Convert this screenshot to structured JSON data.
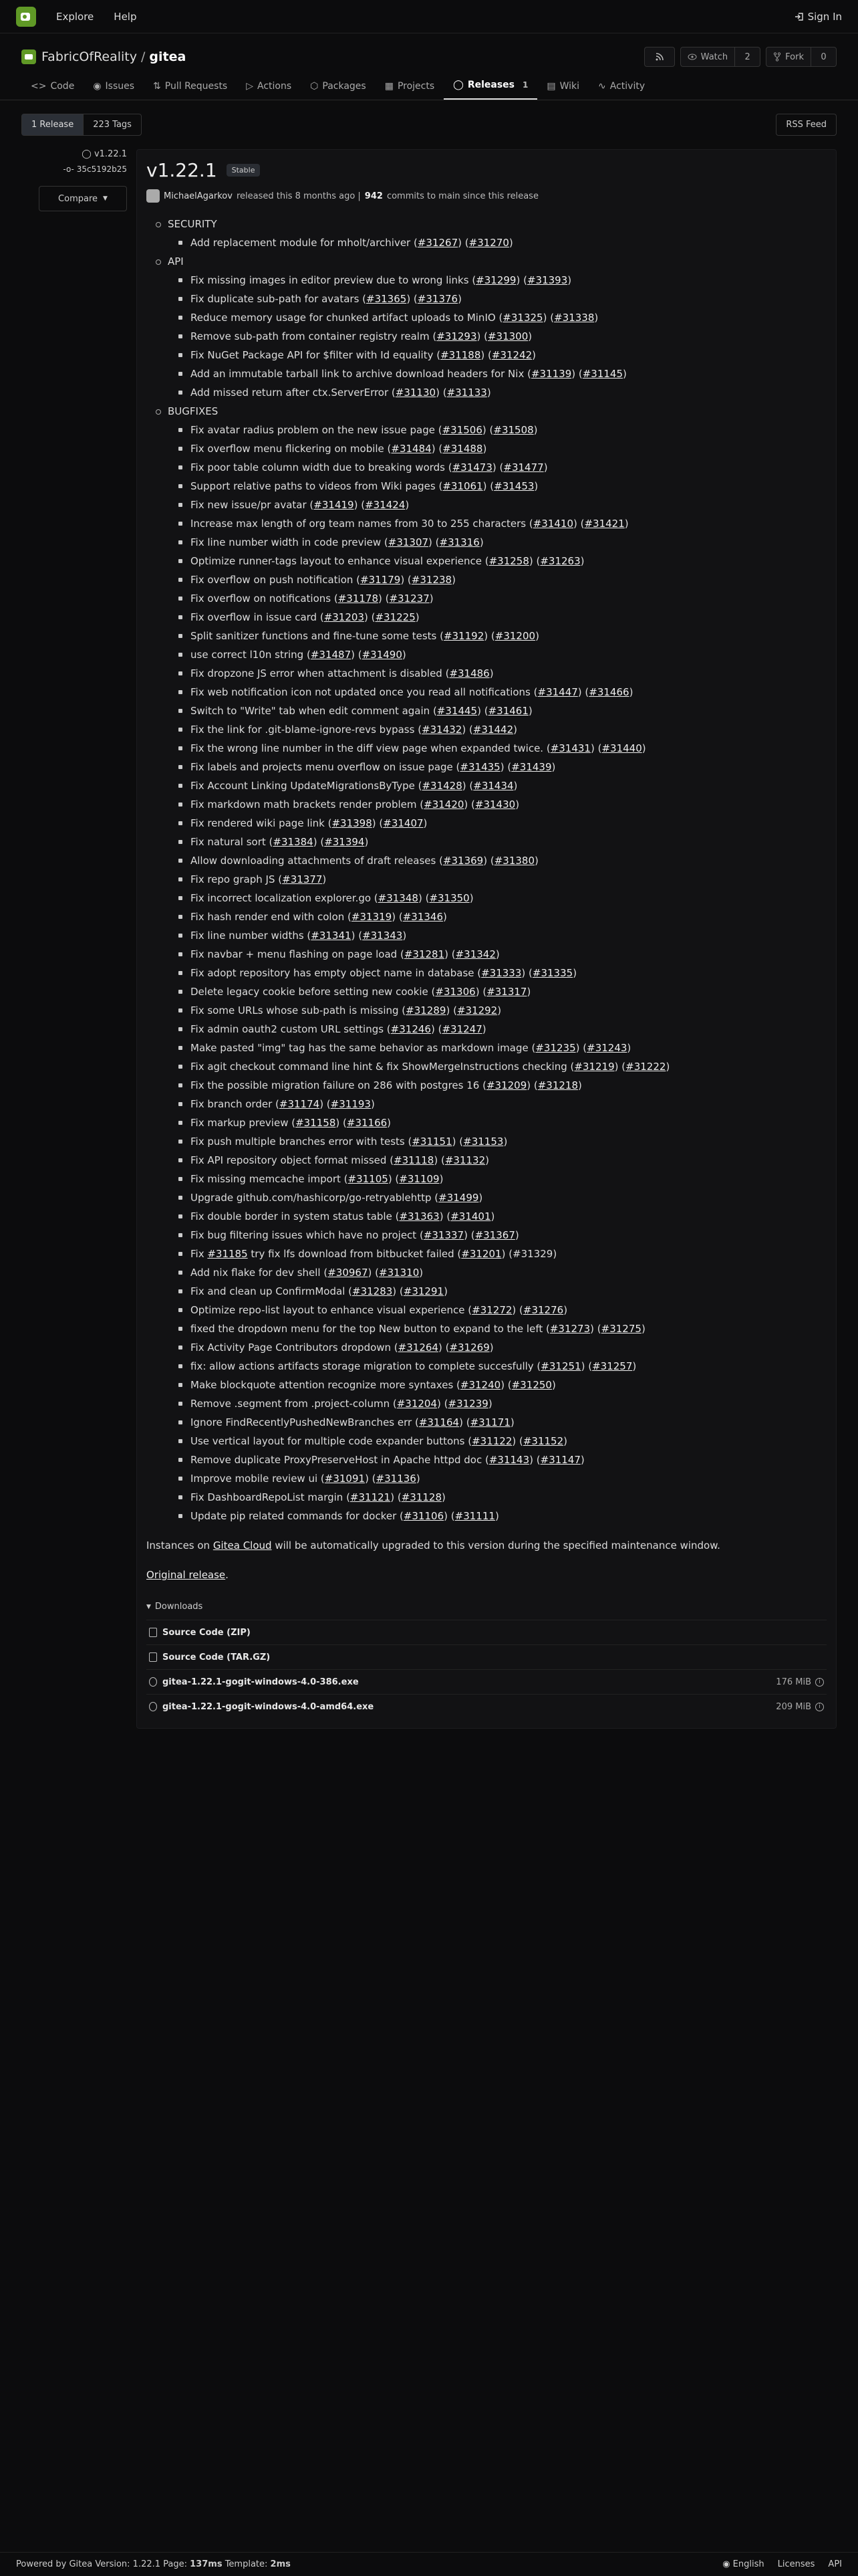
{
  "nav": {
    "explore": "Explore",
    "help": "Help",
    "sign_in": "Sign In"
  },
  "repo": {
    "owner": "FabricOfReality",
    "name": "gitea",
    "watch_label": "Watch",
    "watch_count": "2",
    "fork_label": "Fork",
    "fork_count": "0"
  },
  "tabs": [
    {
      "label": "Code"
    },
    {
      "label": "Issues"
    },
    {
      "label": "Pull Requests"
    },
    {
      "label": "Actions"
    },
    {
      "label": "Packages"
    },
    {
      "label": "Projects"
    },
    {
      "label": "Releases",
      "count": "1"
    },
    {
      "label": "Wiki"
    },
    {
      "label": "Activity"
    }
  ],
  "subbar": {
    "releases": "1 Release",
    "tags": "223 Tags",
    "rss": "RSS Feed"
  },
  "sidebar": {
    "tag": "v1.22.1",
    "commit": "35c5192b25",
    "compare": "Compare"
  },
  "release": {
    "version": "v1.22.1",
    "badge": "Stable",
    "author": "MichaelAgarkov",
    "released_text": "released this 8 months ago |",
    "commits": "942",
    "commits_text": "commits to main since this release"
  },
  "notes": [
    {
      "heading": "SECURITY",
      "items": [
        [
          "Add replacement module for mholt/archiver (",
          "#31267",
          ") (",
          "#31270",
          ")"
        ]
      ]
    },
    {
      "heading": "API",
      "items": [
        [
          "Fix missing images in editor preview due to wrong links (",
          "#31299",
          ") (",
          "#31393",
          ")"
        ],
        [
          "Fix duplicate sub-path for avatars (",
          "#31365",
          ") (",
          "#31376",
          ")"
        ],
        [
          "Reduce memory usage for chunked artifact uploads to MinIO (",
          "#31325",
          ") (",
          "#31338",
          ")"
        ],
        [
          "Remove sub-path from container registry realm (",
          "#31293",
          ") (",
          "#31300",
          ")"
        ],
        [
          "Fix NuGet Package API for $filter with Id equality (",
          "#31188",
          ") (",
          "#31242",
          ")"
        ],
        [
          "Add an immutable tarball link to archive download headers for Nix (",
          "#31139",
          ") (",
          "#31145",
          ")"
        ],
        [
          "Add missed return after ctx.ServerError (",
          "#31130",
          ") (",
          "#31133",
          ")"
        ]
      ]
    },
    {
      "heading": "BUGFIXES",
      "items": [
        [
          "Fix avatar radius problem on the new issue page (",
          "#31506",
          ") (",
          "#31508",
          ")"
        ],
        [
          "Fix overflow menu flickering on mobile (",
          "#31484",
          ") (",
          "#31488",
          ")"
        ],
        [
          "Fix poor table column width due to breaking words (",
          "#31473",
          ") (",
          "#31477",
          ")"
        ],
        [
          "Support relative paths to videos from Wiki pages (",
          "#31061",
          ") (",
          "#31453",
          ")"
        ],
        [
          "Fix new issue/pr avatar (",
          "#31419",
          ") (",
          "#31424",
          ")"
        ],
        [
          "Increase max length of org team names from 30 to 255 characters (",
          "#31410",
          ") (",
          "#31421",
          ")"
        ],
        [
          "Fix line number width in code preview (",
          "#31307",
          ") (",
          "#31316",
          ")"
        ],
        [
          "Optimize runner-tags layout to enhance visual experience (",
          "#31258",
          ") (",
          "#31263",
          ")"
        ],
        [
          "Fix overflow on push notification (",
          "#31179",
          ") (",
          "#31238",
          ")"
        ],
        [
          "Fix overflow on notifications (",
          "#31178",
          ") (",
          "#31237",
          ")"
        ],
        [
          "Fix overflow in issue card (",
          "#31203",
          ") (",
          "#31225",
          ")"
        ],
        [
          "Split sanitizer functions and fine-tune some tests (",
          "#31192",
          ") (",
          "#31200",
          ")"
        ],
        [
          "use correct l10n string (",
          "#31487",
          ") (",
          "#31490",
          ")"
        ],
        [
          "Fix dropzone JS error when attachment is disabled (",
          "#31486",
          ")",
          "",
          ""
        ],
        [
          "Fix web notification icon not updated once you read all notifications (",
          "#31447",
          ") (",
          "#31466",
          ")"
        ],
        [
          "Switch to \"Write\" tab when edit comment again (",
          "#31445",
          ") (",
          "#31461",
          ")"
        ],
        [
          "Fix the link for .git-blame-ignore-revs bypass (",
          "#31432",
          ") (",
          "#31442",
          ")"
        ],
        [
          "Fix the wrong line number in the diff view page when expanded twice. (",
          "#31431",
          ") (",
          "#31440",
          ")"
        ],
        [
          "Fix labels and projects menu overflow on issue page (",
          "#31435",
          ") (",
          "#31439",
          ")"
        ],
        [
          "Fix Account Linking UpdateMigrationsByType (",
          "#31428",
          ") (",
          "#31434",
          ")"
        ],
        [
          "Fix markdown math brackets render problem (",
          "#31420",
          ") (",
          "#31430",
          ")"
        ],
        [
          "Fix rendered wiki page link (",
          "#31398",
          ") (",
          "#31407",
          ")"
        ],
        [
          "Fix natural sort (",
          "#31384",
          ") (",
          "#31394",
          ")"
        ],
        [
          "Allow downloading attachments of draft releases (",
          "#31369",
          ") (",
          "#31380",
          ")"
        ],
        [
          "Fix repo graph JS (",
          "#31377",
          ")",
          "",
          ""
        ],
        [
          "Fix incorrect localization explorer.go (",
          "#31348",
          ") (",
          "#31350",
          ")"
        ],
        [
          "Fix hash render end with colon (",
          "#31319",
          ") (",
          "#31346",
          ")"
        ],
        [
          "Fix line number widths (",
          "#31341",
          ") (",
          "#31343",
          ")"
        ],
        [
          "Fix navbar + menu flashing on page load (",
          "#31281",
          ") (",
          "#31342",
          ")"
        ],
        [
          "Fix adopt repository has empty object name in database (",
          "#31333",
          ") (",
          "#31335",
          ")"
        ],
        [
          "Delete legacy cookie before setting new cookie (",
          "#31306",
          ") (",
          "#31317",
          ")"
        ],
        [
          "Fix some URLs whose sub-path is missing (",
          "#31289",
          ") (",
          "#31292",
          ")"
        ],
        [
          "Fix admin oauth2 custom URL settings (",
          "#31246",
          ") (",
          "#31247",
          ")"
        ],
        [
          "Make pasted \"img\" tag has the same behavior as markdown image (",
          "#31235",
          ") (",
          "#31243",
          ")"
        ],
        [
          "Fix agit checkout command line hint & fix ShowMergeInstructions checking (",
          "#31219",
          ") (",
          "#31222",
          ")"
        ],
        [
          "Fix the possible migration failure on 286 with postgres 16 (",
          "#31209",
          ") (",
          "#31218",
          ")"
        ],
        [
          "Fix branch order (",
          "#31174",
          ") (",
          "#31193",
          ")"
        ],
        [
          "Fix markup preview (",
          "#31158",
          ") (",
          "#31166",
          ")"
        ],
        [
          "Fix push multiple branches error with tests (",
          "#31151",
          ") (",
          "#31153",
          ")"
        ],
        [
          "Fix API repository object format missed (",
          "#31118",
          ") (",
          "#31132",
          ")"
        ],
        [
          "Fix missing memcache import (",
          "#31105",
          ") (",
          "#31109",
          ")"
        ],
        [
          "Upgrade github.com/hashicorp/go-retryablehttp (",
          "#31499",
          ")",
          "",
          ""
        ],
        [
          "Fix double border in system status table (",
          "#31363",
          ") (",
          "#31401",
          ")"
        ],
        [
          "Fix bug filtering issues which have no project (",
          "#31337",
          ") (",
          "#31367",
          ")"
        ],
        [
          "Fix ",
          "#31185",
          " try fix lfs download from bitbucket failed (",
          "#31201",
          ") (#31329)"
        ],
        [
          "Add nix flake for dev shell (",
          "#30967",
          ") (",
          "#31310",
          ")"
        ],
        [
          "Fix and clean up ConfirmModal (",
          "#31283",
          ") (",
          "#31291",
          ")"
        ],
        [
          "Optimize repo-list layout to enhance visual experience (",
          "#31272",
          ") (",
          "#31276",
          ")"
        ],
        [
          "fixed the dropdown menu for the top New button to expand to the left (",
          "#31273",
          ") (",
          "#31275",
          ")"
        ],
        [
          "Fix Activity Page Contributors dropdown (",
          "#31264",
          ") (",
          "#31269",
          ")"
        ],
        [
          "fix: allow actions artifacts storage migration to complete succesfully (",
          "#31251",
          ") (",
          "#31257",
          ")"
        ],
        [
          "Make blockquote attention recognize more syntaxes (",
          "#31240",
          ") (",
          "#31250",
          ")"
        ],
        [
          "Remove .segment from .project-column (",
          "#31204",
          ") (",
          "#31239",
          ")"
        ],
        [
          "Ignore FindRecentlyPushedNewBranches err (",
          "#31164",
          ") (",
          "#31171",
          ")"
        ],
        [
          "Use vertical layout for multiple code expander buttons (",
          "#31122",
          ") (",
          "#31152",
          ")"
        ],
        [
          "Remove duplicate ProxyPreserveHost in Apache httpd doc (",
          "#31143",
          ") (",
          "#31147",
          ")"
        ],
        [
          "Improve mobile review ui (",
          "#31091",
          ") (",
          "#31136",
          ")"
        ],
        [
          "Fix DashboardRepoList margin (",
          "#31121",
          ") (",
          "#31128",
          ")"
        ],
        [
          "Update pip related commands for docker (",
          "#31106",
          ") (",
          "#31111",
          ")"
        ]
      ]
    }
  ],
  "after": {
    "cloud_prefix": "Instances on ",
    "cloud_link": "Gitea Cloud",
    "cloud_suffix": " will be automatically upgraded to this version during the specified maintenance window.",
    "original_link": "Original release",
    "original_suffix": "."
  },
  "downloads": {
    "heading": "Downloads",
    "files": [
      {
        "name": "Source Code (ZIP)",
        "size": ""
      },
      {
        "name": "Source Code (TAR.GZ)",
        "size": ""
      },
      {
        "name": "gitea-1.22.1-gogit-windows-4.0-386.exe",
        "size": "176 MiB"
      },
      {
        "name": "gitea-1.22.1-gogit-windows-4.0-amd64.exe",
        "size": "209 MiB"
      }
    ]
  },
  "footer": {
    "powered_by": "Powered by Gitea Version: 1.22.1 Page: ",
    "page_time": "137ms",
    "template_label": " Template: ",
    "template_time": "2ms",
    "language": "English",
    "licenses": "Licenses",
    "api": "API"
  }
}
